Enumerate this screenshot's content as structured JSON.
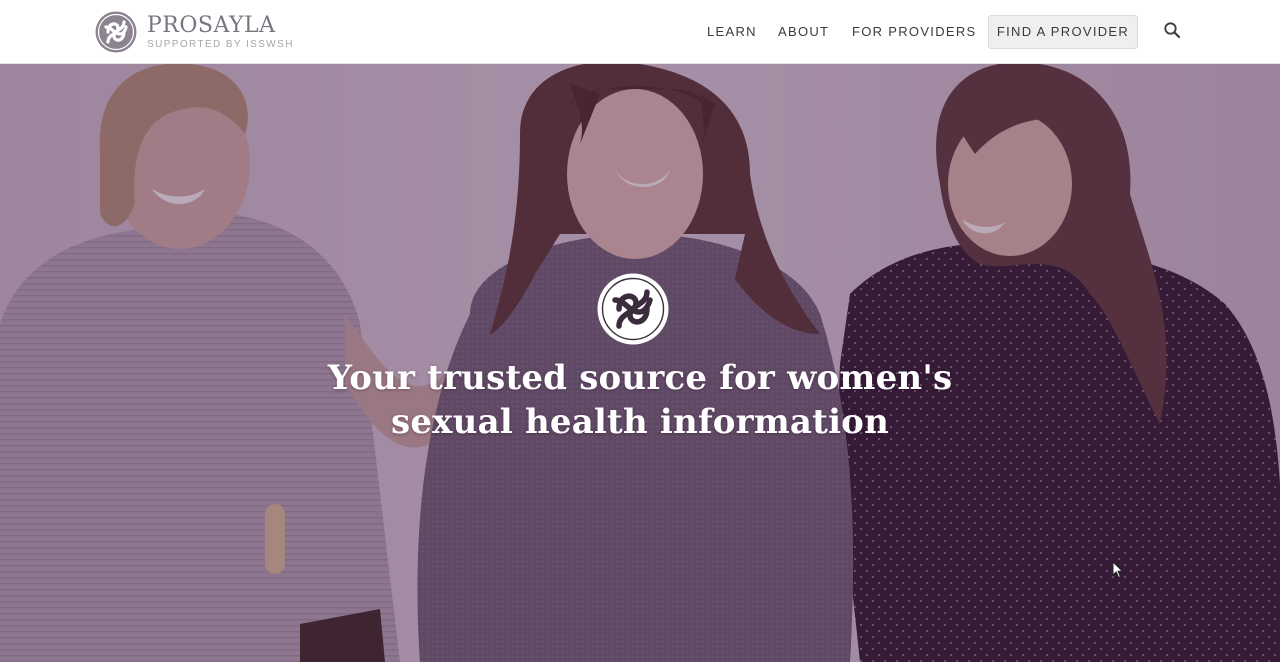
{
  "header": {
    "brand": {
      "name": "PROSAYLA",
      "tagline": "SUPPORTED BY ISSWSH",
      "icon": "prosayla-knot-logo"
    },
    "nav": [
      {
        "label": "LEARN"
      },
      {
        "label": "ABOUT"
      },
      {
        "label": "FOR PROVIDERS"
      }
    ],
    "cta_label": "FIND A PROVIDER",
    "search_icon": "search-icon"
  },
  "hero": {
    "image": "three smiling women standing together, purple-tinted photo",
    "emblem_icon": "prosayla-knot-emblem",
    "heading_line1": "Your trusted source for women's",
    "heading_line2": "sexual health information"
  },
  "colors": {
    "overlay": "#461c46",
    "brand_gray": "#7a7380",
    "nav_text": "#3b3b3b",
    "cta_bg": "#efeff1"
  }
}
